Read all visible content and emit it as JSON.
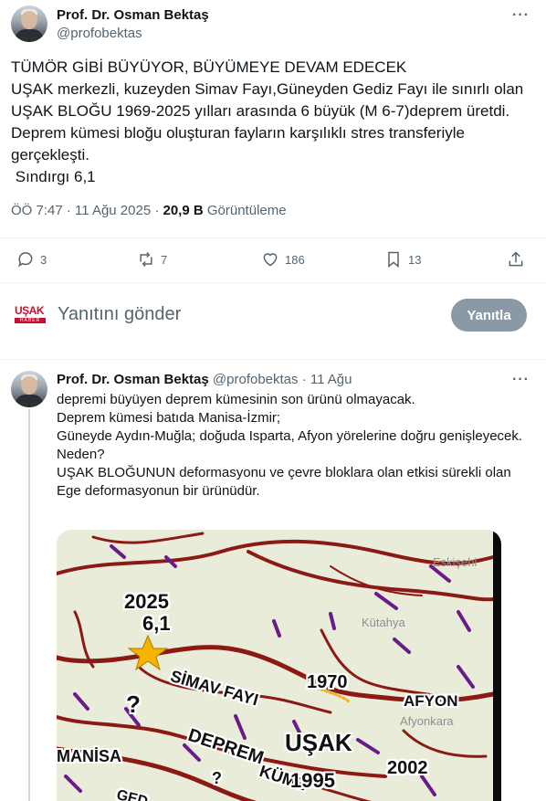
{
  "tweet": {
    "author_name": "Prof. Dr. Osman Bektaş",
    "author_handle": "@profobektas",
    "text": "TÜMÖR GİBİ BÜYÜYOR, BÜYÜMEYE DEVAM EDECEK\nUŞAK merkezli, kuzeyden Simav Fayı,Güneyden Gediz Fayı ile sınırlı olan UŞAK BLOĞU 1969-2025 yılları arasında 6 büyük (M 6-7)deprem üretdi.\nDeprem kümesi bloğu oluşturan fayların karşılıklı stres transferiyle gerçekleşti.\n Sındırgı 6,1",
    "timestamp": "ÖÖ 7:47 · 11 Ağu 2025 · ",
    "views_count": "20,9 B",
    "views_label": " Görüntüleme",
    "more_label": "···",
    "actions": {
      "replies": "3",
      "reposts": "7",
      "likes": "186",
      "bookmarks": "13"
    }
  },
  "reply_box": {
    "logo_text": "UŞAK",
    "logo_sub": "HABER",
    "placeholder": "Yanıtını gönder",
    "button_label": "Yanıtla"
  },
  "reply_tweet": {
    "author_name": "Prof. Dr. Osman Bektaş",
    "author_handle": "@profobektas",
    "separator": " · ",
    "date": "11 Ağu",
    "more_label": "···",
    "text": "depremi büyüyen deprem kümesinin son ürünü olmayacak.\nDeprem kümesi batıda Manisa-İzmir;\nGüneyde Aydın-Muğla; doğuda Isparta, Afyon yörelerine doğru genişleyecek.\nNeden?\nUŞAK BLOĞUNUN deformasyonu ve çevre bloklara olan etkisi sürekli olan Ege deformasyonun bir ürünüdür."
  },
  "map": {
    "labels": {
      "year_2025": "2025",
      "mag": "6,1",
      "simav": "SİMAV FAYI",
      "q1": "?",
      "q2": "?",
      "year_1970": "1970",
      "afyon": "AFYON",
      "afyonkara": "Afyonkara",
      "usak": "UŞAK",
      "manisa": "MANİSA",
      "deprem": "DEPREM",
      "kume": "KÜME",
      "year_1995": "1995",
      "year_2002": "2002",
      "eskisehir": "Eskişehi",
      "kutahya": "Kütahya",
      "ged": "GED"
    }
  }
}
